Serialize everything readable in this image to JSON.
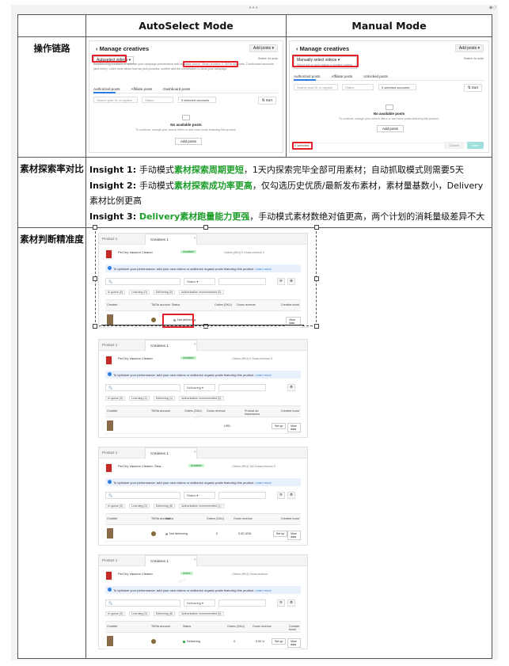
{
  "window": {
    "top_dots": "•••",
    "top_right": "◆◇"
  },
  "table": {
    "header": {
      "col1": "",
      "col2": "AutoSelect Mode",
      "col3": "Manual Mode"
    },
    "rows": [
      {
        "label": "操作链路"
      },
      {
        "label": "素材探索率对比"
      },
      {
        "label": "素材判断精准度"
      }
    ]
  },
  "auto_panel": {
    "title": "Manage creatives",
    "add_posts": "Add posts ▾",
    "selector": "Autoselect videos",
    "selector_right": "Switch to auto",
    "description": "Autoselecting creatives to optimize your campaign performance with available videos. Smart creative: 5 TikTok accounts, 2 authorized accounts (and more). Learn more about how we pick products, content and the combination to show your campaign.",
    "tabs": [
      "Authorized posts",
      "Affiliate posts",
      "Dashboard posts"
    ],
    "filters": [
      "Search post ID or caption",
      "Status",
      "5 selected accounts"
    ],
    "sort": "Sort",
    "empty_title": "No available posts",
    "empty_sub": "To continue, change your search filters or add more posts featuring this product.",
    "add_btn": "Add posts"
  },
  "manual_panel": {
    "title": "Manage creatives",
    "add_posts": "Add posts ▾",
    "selector": "Manually select videos",
    "selector_sub": "Select one or more videos or creative options",
    "selector_right": "Switch to auto",
    "tabs": [
      "Authorized posts",
      "Affiliate posts",
      "Unlocked posts"
    ],
    "filters": [
      "Search post ID or caption",
      "Status",
      "5 selected accounts"
    ],
    "sort": "Sort",
    "empty_title": "No available posts",
    "empty_sub": "To continue, change your search filters or add more posts featuring this product.",
    "add_btn": "Add posts",
    "selected": "0 selected",
    "cancel": "Cancel",
    "save": "Save"
  },
  "insights": [
    {
      "prefix": "Insight 1: ",
      "pre": "手动模式",
      "highlight": "素材探索周期更短",
      "rest": "，1天内探索完毕全部可用素材；自动抓取模式则需要5天"
    },
    {
      "prefix": "Insight 2: ",
      "pre": "手动模式",
      "highlight": "素材探索成功率更高",
      "rest": "，仅勾选历史优质/最新发布素材，素材量基数小，Delivery素材比例更高"
    },
    {
      "prefix": "Insight 3: ",
      "pre": "",
      "highlight": "Delivery素材跑量能力更强",
      "rest": "，手动模式素材数绝对值更高，两个计划的消耗量级差异不大"
    }
  ],
  "screenshots": [
    {
      "tab_product": "Product 1",
      "tab_creatives": "Creatives 1",
      "close": "×",
      "product": "Pet Dry Vacuum Cleaner",
      "badge": "Available",
      "metric": "Orders (SKU) 0   Gross revenue 0",
      "banner": "To optimize your performance, add your own videos or authorize organic posts featuring this product.",
      "banner_link": "Learn more",
      "status_filter": "Status ▾",
      "subtabs": [
        "In queue (0)",
        "Learning (0)",
        "Delivering (0)",
        "Authorization recommended (0)"
      ],
      "headers": [
        "Creative",
        "TikTok account",
        "Status",
        "Orders (SKU)",
        "Gross revenue",
        "Creative boost"
      ],
      "status": "Not delivering",
      "orders": "",
      "revenue": "",
      "btn1": "",
      "btn2": "View data"
    },
    {
      "tab_product": "Product 1",
      "tab_creatives": "Creatives 1",
      "close": "×",
      "product": "Pet Dry Vacuum Cleaner",
      "badge": "Available",
      "metric": "Orders (SKU) 0   Gross revenue 0",
      "banner": "To optimize your performance, add your own videos or authorize organic posts featuring this product.",
      "banner_link": "Learn more",
      "status_filter": "Delivering ▾",
      "subtabs": [
        "In queue (0)",
        "Learning (1)",
        "Delivering (1)",
        "Authorization recommended (0)"
      ],
      "headers": [
        "Creative",
        "TikTok account",
        "Orders (SKU)",
        "Gross revenue",
        "Product ad impressions",
        "Creative boost"
      ],
      "status": "",
      "orders": "",
      "revenue": "USD",
      "btn1": "Set up",
      "btn2": "View data"
    },
    {
      "tab_product": "Product 1",
      "tab_creatives": "Creatives 1",
      "close": "×",
      "product": "Pet Dry Vacuum Cleaner, Stea...",
      "badge": "Available",
      "metric": "Orders (SKU) 154   Gross revenue 0",
      "banner": "To optimize your performance, add your own videos or authorize organic posts featuring this product.",
      "banner_link": "Learn more",
      "status_filter": "Status ▾",
      "subtabs": [
        "In queue (0)",
        "Learning (0)",
        "Delivering (0)",
        "Authorization recommended (0)"
      ],
      "headers": [
        "Creative",
        "TikTok account",
        "Status",
        "Orders (SKU)",
        "Gross revenue",
        "Creative boost"
      ],
      "status": "Not delivering",
      "orders": "0",
      "revenue": "0.00 USD",
      "btn1": "Set up",
      "btn2": "View data"
    },
    {
      "tab_product": "Product 1",
      "tab_creatives": "Creatives 1",
      "close": "×",
      "product": "Pet Dry Vacuum Cleaner",
      "badge": "Active",
      "metric": "Orders (SKU)   Gross revenue",
      "banner": "To optimize your performance, add your own videos or authorize organic posts featuring this product.",
      "banner_link": "Learn more",
      "status_filter": "Delivering ▾",
      "subtabs": [
        "In queue (0)",
        "Learning (0)",
        "Delivering (0)",
        "Authorization recommended (0)"
      ],
      "headers": [
        "Creative",
        "TikTok account",
        "Status",
        "Orders (SKU)",
        "Gross revenue",
        "Creative boost"
      ],
      "status": "Delivering",
      "orders": "0",
      "revenue": "0.00 U",
      "btn1": "Set up",
      "btn2": "View data"
    }
  ]
}
